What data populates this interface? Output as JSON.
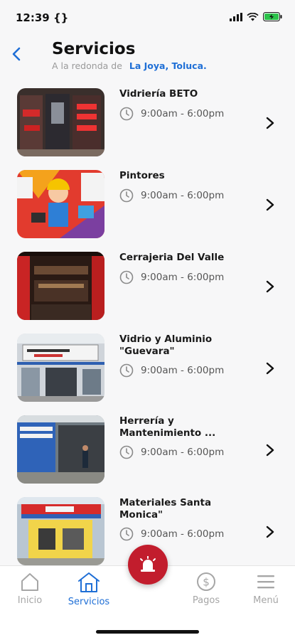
{
  "status_bar": {
    "time": "12:39 {}"
  },
  "header": {
    "title": "Servicios",
    "subtitle_prefix": "A la redonda de",
    "location": "La Joya, Toluca."
  },
  "services": [
    {
      "name": "Vidriería BETO",
      "hours": "9:00am - 6:00pm"
    },
    {
      "name": "Pintores",
      "hours": "9:00am - 6:00pm"
    },
    {
      "name": "Cerrajeria Del Valle",
      "hours": "9:00am - 6:00pm"
    },
    {
      "name": "Vidrio y Aluminio \"Guevara\"",
      "hours": "9:00am - 6:00pm"
    },
    {
      "name": "Herrería y Mantenimiento ...",
      "hours": "9:00am - 6:00pm"
    },
    {
      "name": "Materiales Santa Monica\"",
      "hours": "9:00am - 6:00pm"
    }
  ],
  "tabs": {
    "inicio": "Inicio",
    "servicios": "Servicios",
    "pagos": "Pagos",
    "menu": "Menú"
  },
  "colors": {
    "accent": "#1f6fd6",
    "fab": "#c21d2d",
    "inactive": "#a6a6a6"
  }
}
